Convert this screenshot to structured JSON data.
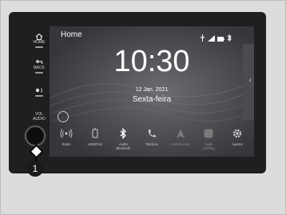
{
  "side_buttons": {
    "home_label": "HOME",
    "back_label": "BACK",
    "vol_label": "VOL\nAUDIO"
  },
  "screen": {
    "title": "Home",
    "time": "10:30",
    "date": "12 Jan. 2021",
    "weekday": "Sexta-feira"
  },
  "apps": [
    {
      "label": "Rádio",
      "icon": "radio-icon"
    },
    {
      "label": "USB/iPod",
      "icon": "usb-icon"
    },
    {
      "label": "Audio Bluetooth",
      "icon": "bluetooth-icon"
    },
    {
      "label": "Telefone",
      "icon": "phone-icon"
    },
    {
      "label": "Android Auto",
      "icon": "android-auto-icon"
    },
    {
      "label": "Apple CarPlay",
      "icon": "carplay-icon"
    },
    {
      "label": "Ajustes",
      "icon": "gear-icon"
    }
  ],
  "callout": {
    "number": "1"
  }
}
